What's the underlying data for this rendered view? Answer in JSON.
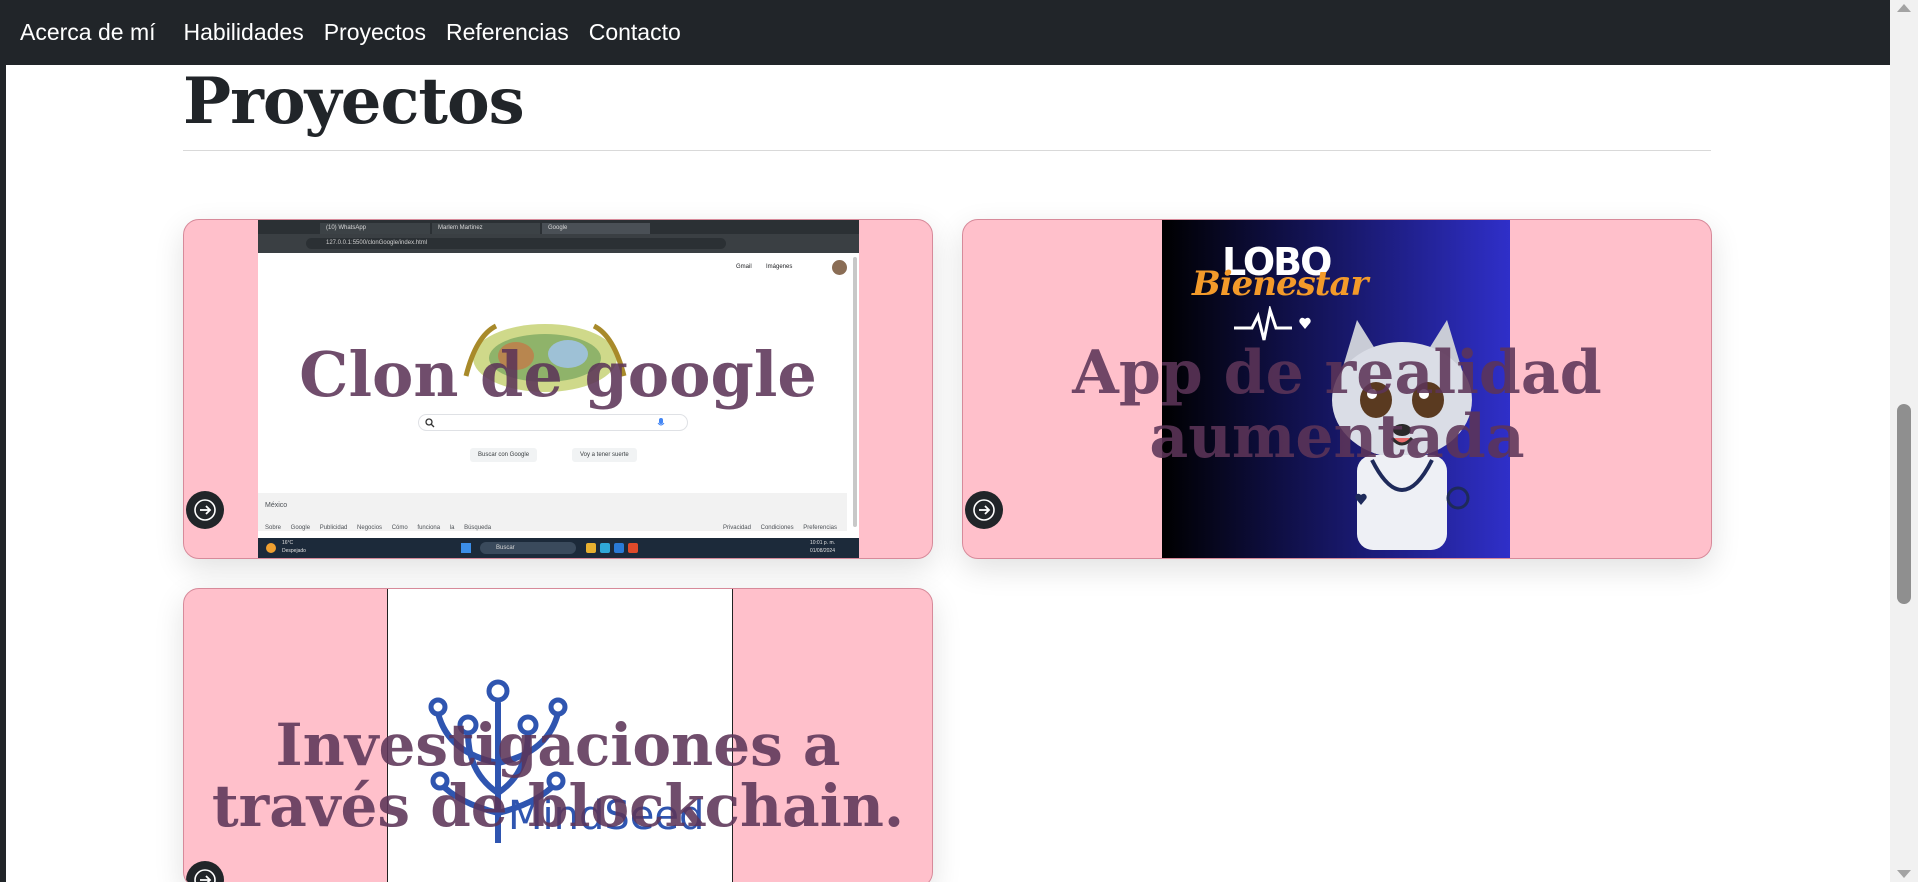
{
  "nav": {
    "items": [
      "Acerca de mí",
      "Habilidades",
      "Proyectos",
      "Referencias",
      "Contacto"
    ]
  },
  "section": {
    "title": "Proyectos"
  },
  "projects": [
    {
      "title": "Clon de google",
      "thumbnail": {
        "tabs": [
          "(10) WhatsApp",
          "Marlem Martinez",
          "Google"
        ],
        "url": "127.0.0.1:5500/clonGoogle/index.html",
        "top_links": [
          "Gmail",
          "Imágenes"
        ],
        "buttons": [
          "Buscar con Google",
          "Voy a tener suerte"
        ],
        "country": "México",
        "footer_left": "Sobre Google  Publicidad  Negocios  Cómo funciona la Búsqueda",
        "footer_right": "Privacidad  Condiciones  Preferencias",
        "taskbar_search": "Buscar",
        "weather_temp": "16°C",
        "weather_desc": "Despejado",
        "clock_time": "10:01 p. m.",
        "clock_date": "01/08/2024"
      }
    },
    {
      "title": "App de realidad aumentada",
      "thumbnail": {
        "brand_word_1": "LOBO",
        "brand_word_2": "Bienestar"
      }
    },
    {
      "title": "Investigaciones a través de blockchain.",
      "thumbnail": {
        "brand_text": "MindSeed"
      }
    }
  ],
  "colors": {
    "navbar": "#212529",
    "card_bg": "#ffc0cb",
    "card_title": "#5c3458",
    "heading": "#212529"
  },
  "icons": [
    "arrow-right-icon",
    "scroll-up-icon",
    "scroll-down-icon"
  ]
}
